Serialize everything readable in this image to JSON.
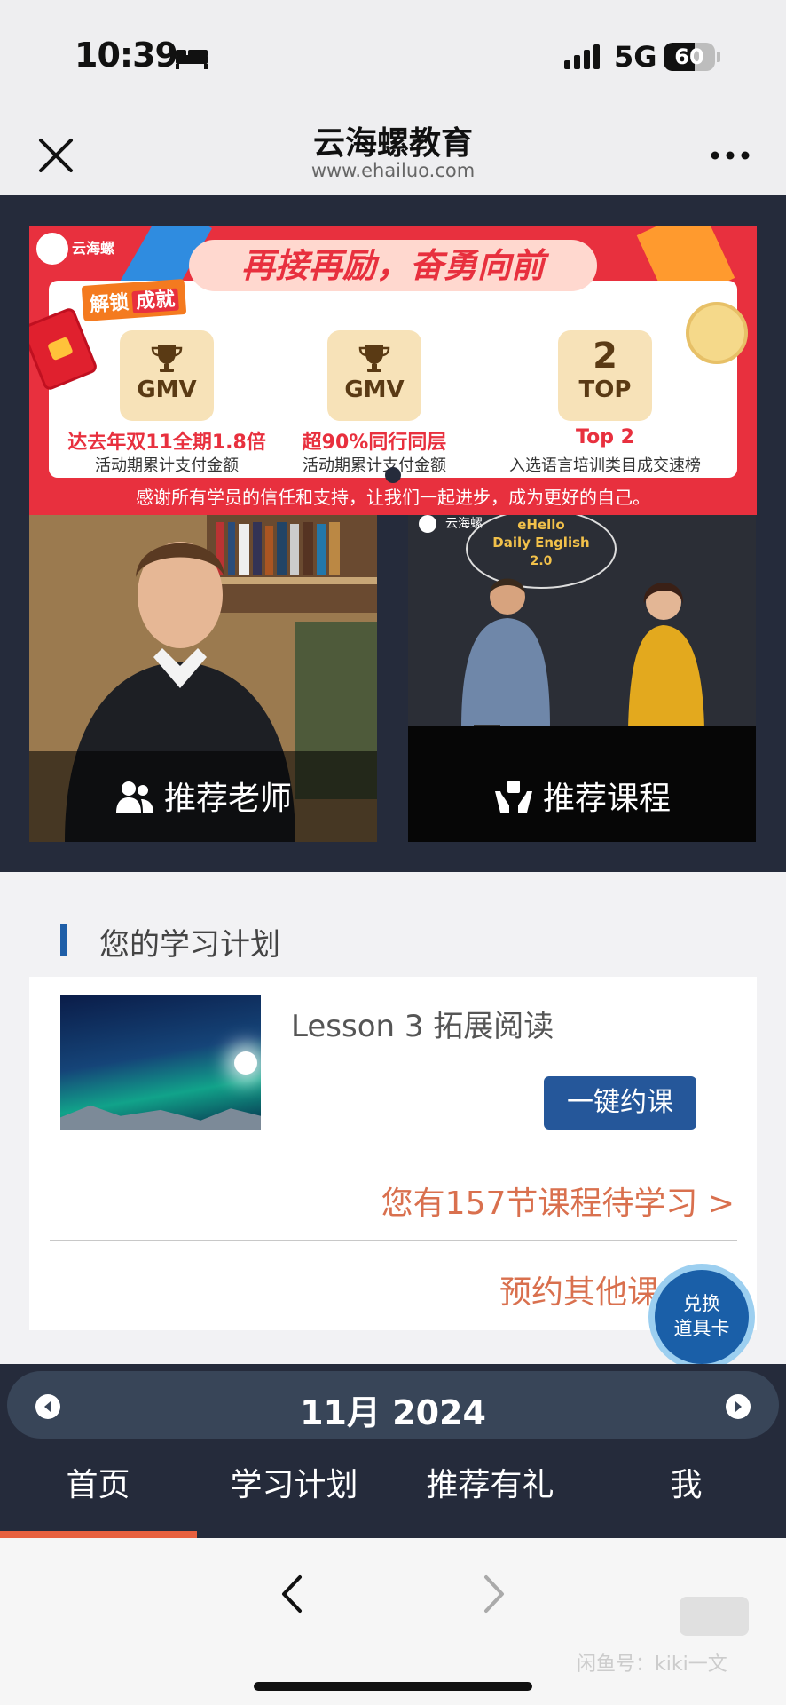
{
  "status_bar": {
    "time": "10:39",
    "network": "5G",
    "battery_percent": 60,
    "battery_label": "60"
  },
  "title_bar": {
    "title": "云海螺教育",
    "subtitle": "www.ehailuo.com"
  },
  "banner": {
    "brand": "云海螺",
    "headline": "再接再励，奋勇向前",
    "unlock_tag_a": "解锁",
    "unlock_tag_b": "成就",
    "badges": [
      {
        "icon": "trophy-icon",
        "label": "GMV",
        "main": "达去年双11全期1.8倍",
        "sub": "活动期累计支付金额"
      },
      {
        "icon": "trophy-icon",
        "label": "GMV",
        "main": "超90%同行同层",
        "sub": "活动期累计支付金额"
      },
      {
        "icon": "rank-icon",
        "number": "2",
        "label": "TOP",
        "main": "Top 2",
        "sub": "入选语言培训类目成交速榜"
      }
    ],
    "footer": "感谢所有学员的信任和支持，让我们一起进步，成为更好的自己。"
  },
  "promo_cards": {
    "teacher_label": "推荐老师",
    "course_label": "推荐课程",
    "course_bubble_a": "eHello",
    "course_bubble_b": "Daily English",
    "course_bubble_c": "2.0"
  },
  "study_plan": {
    "section_title": "您的学习计划",
    "lesson_title": "Lesson 3 拓展阅读",
    "book_button": "一键约课",
    "pending_text": "您有157节课程待学习 >",
    "book_other": "预约其他课"
  },
  "fab": {
    "line1": "兑换",
    "line2": "道具卡"
  },
  "calendar": {
    "month_label": "11月 2024"
  },
  "tabs": [
    {
      "label": "首页",
      "active": true
    },
    {
      "label": "学习计划",
      "active": false
    },
    {
      "label": "推荐有礼",
      "active": false
    },
    {
      "label": "我",
      "active": false
    }
  ],
  "watermark": {
    "logo_text": "闲鱼",
    "text": "闲鱼号：kiki一文"
  },
  "colors": {
    "dark_band": "#252b3b",
    "banner_red": "#e8303e",
    "accent_orange": "#d9704e",
    "button_blue": "#25579a",
    "tab_underline": "#e8603e"
  }
}
